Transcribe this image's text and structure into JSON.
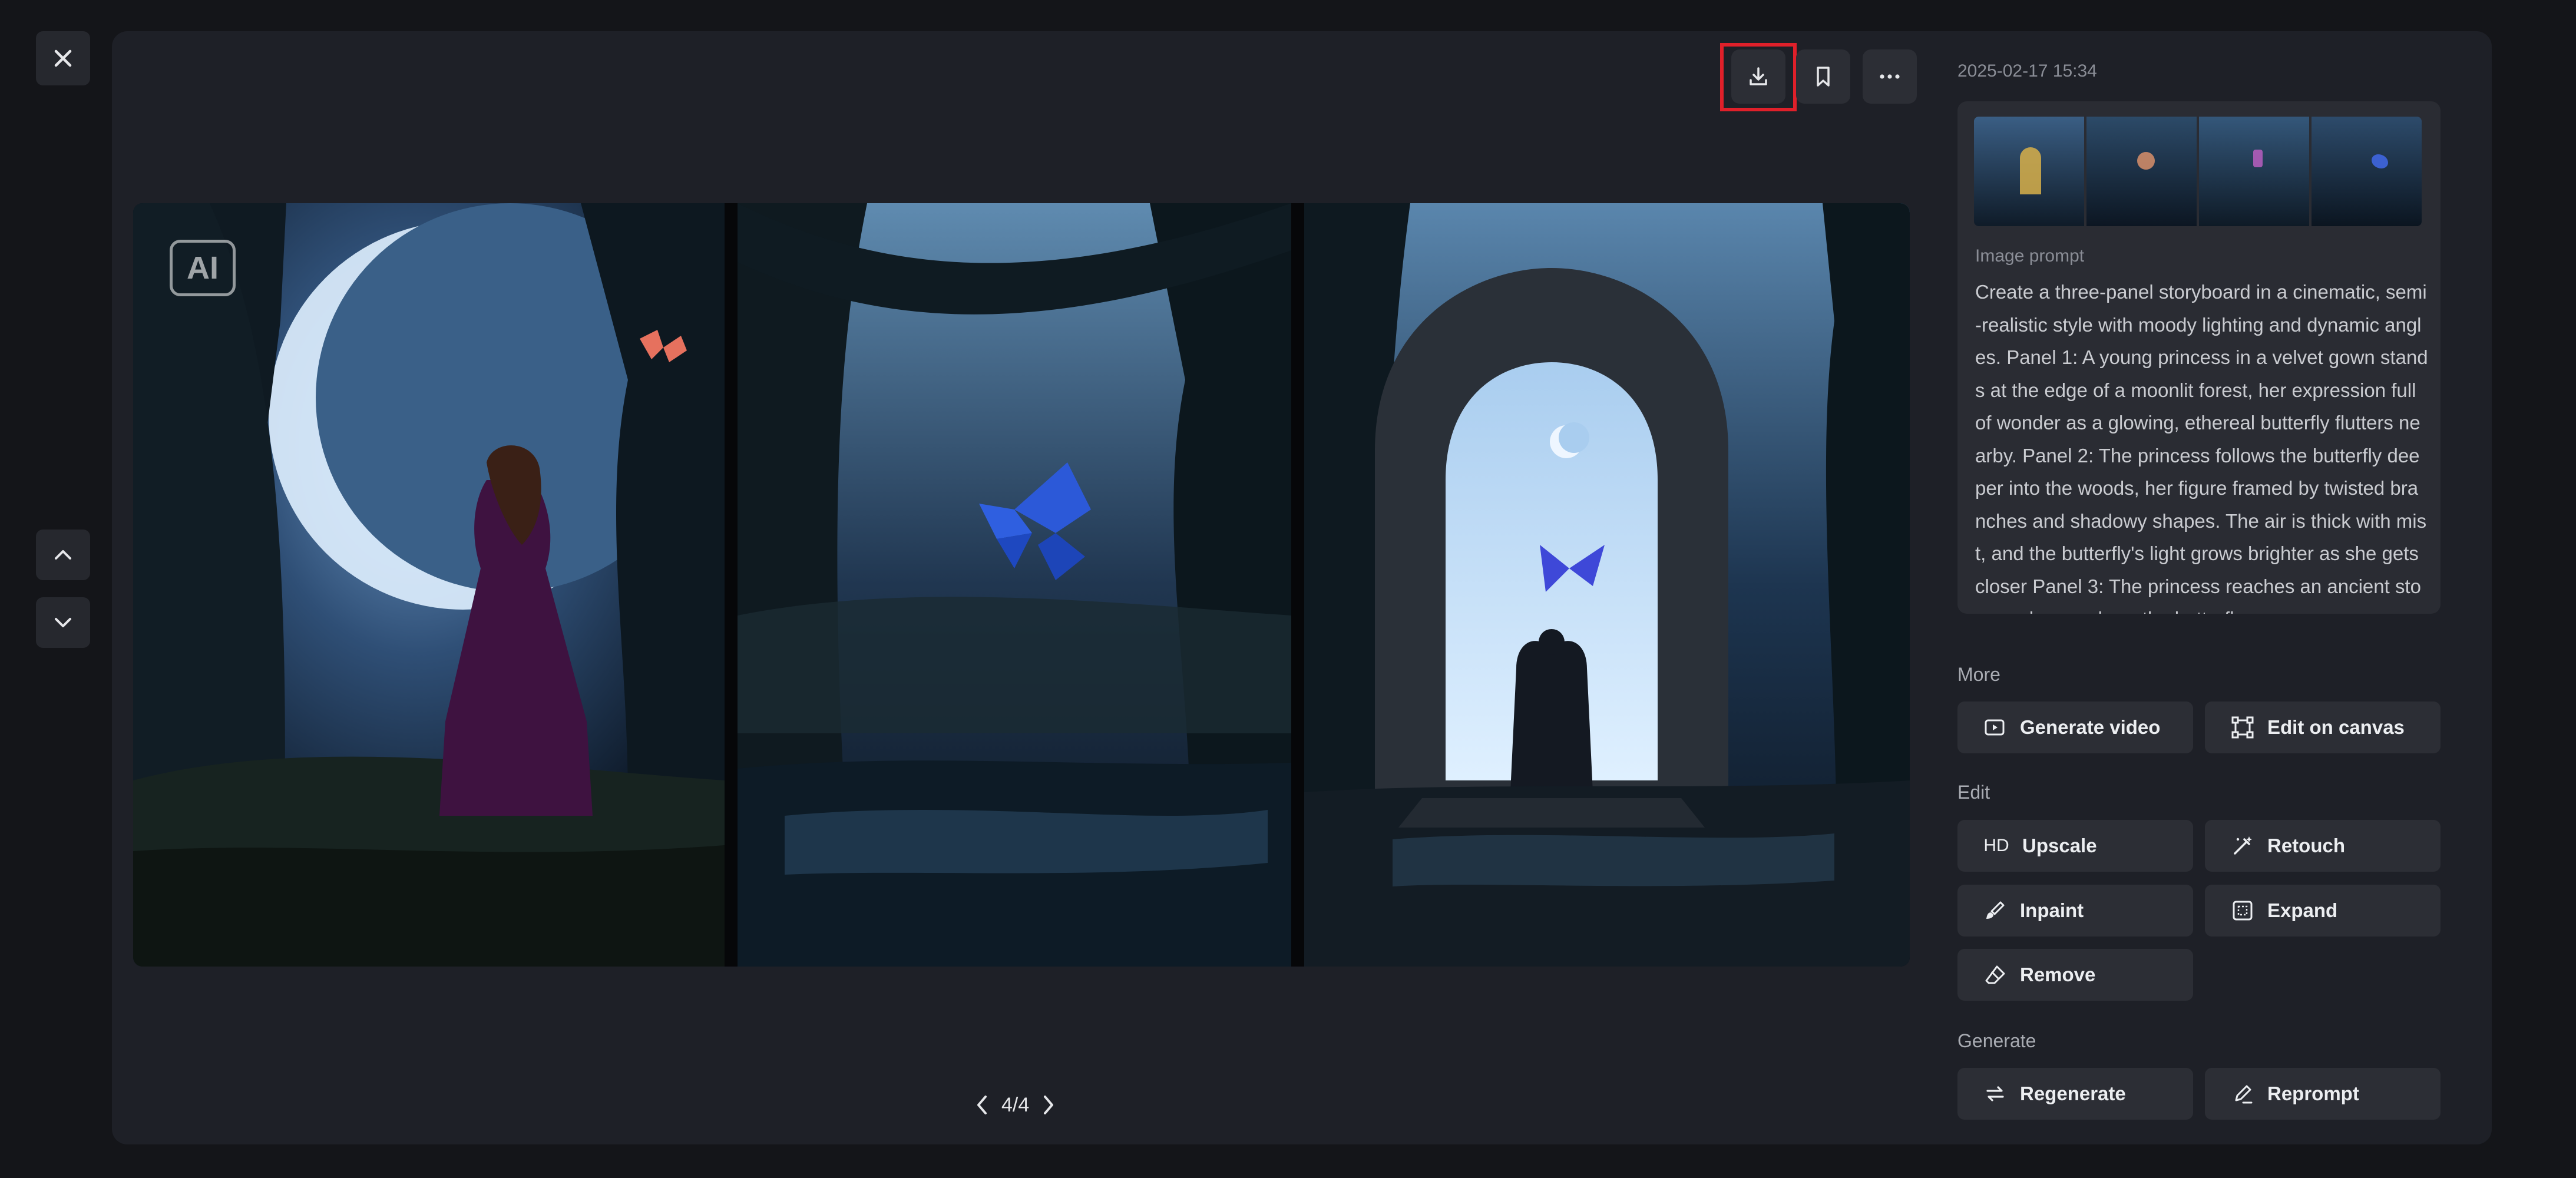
{
  "timestamp": "2025-02-17 15:34",
  "prompt": {
    "label": "Image prompt",
    "text": "Create a three-panel storyboard in a cinematic, semi-realistic style with moody lighting and dynamic angles. Panel 1: A young princess in a velvet gown stands at the edge of a moonlit forest, her expression full of wonder as a glowing, ethereal butterfly flutters nearby. Panel 2: The princess follows the butterfly deeper into the woods, her figure framed by twisted branches and shadowy shapes. The air is thick with mist, and the butterfly's light grows brighter as she gets closer Panel 3: The princess reaches an ancient stone archway, where the butterfl"
  },
  "badge": "AI",
  "pager": {
    "count": "4/4"
  },
  "sections": {
    "more": "More",
    "edit": "Edit",
    "generate": "Generate"
  },
  "buttons": {
    "generate_video": "Generate video",
    "edit_on_canvas": "Edit on canvas",
    "upscale": "Upscale",
    "upscale_icon_text": "HD",
    "retouch": "Retouch",
    "inpaint": "Inpaint",
    "expand": "Expand",
    "remove": "Remove",
    "regenerate": "Regenerate",
    "reprompt": "Reprompt"
  },
  "icons": {
    "close": "close-icon",
    "up": "chevron-up-icon",
    "down": "chevron-down-icon",
    "download": "download-icon",
    "bookmark": "bookmark-icon",
    "more": "more-horizontal-icon"
  },
  "colors": {
    "highlight": "#e0202a",
    "background": "#141519",
    "panel": "#1e2027"
  }
}
